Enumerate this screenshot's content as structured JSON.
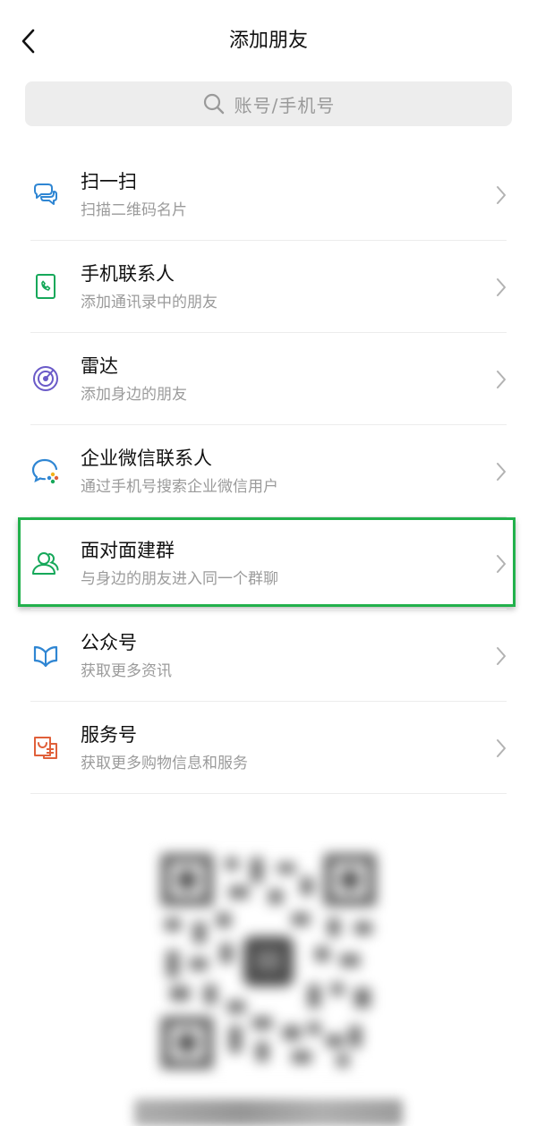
{
  "header": {
    "title": "添加朋友"
  },
  "search": {
    "placeholder": "账号/手机号"
  },
  "menu": {
    "items": [
      {
        "title": "扫一扫",
        "subtitle": "扫描二维码名片",
        "icon": "scan-icon",
        "color": "#2f86d3"
      },
      {
        "title": "手机联系人",
        "subtitle": "添加通讯录中的朋友",
        "icon": "phone-contact-icon",
        "color": "#16a85a"
      },
      {
        "title": "雷达",
        "subtitle": "添加身边的朋友",
        "icon": "radar-icon",
        "color": "#6a5ac8"
      },
      {
        "title": "企业微信联系人",
        "subtitle": "通过手机号搜索企业微信用户",
        "icon": "wecom-icon",
        "color": "#2f86d3"
      },
      {
        "title": "面对面建群",
        "subtitle": "与身边的朋友进入同一个群聊",
        "icon": "group-icon",
        "color": "#16a85a"
      },
      {
        "title": "公众号",
        "subtitle": "获取更多资讯",
        "icon": "official-account-icon",
        "color": "#2f86d3"
      },
      {
        "title": "服务号",
        "subtitle": "获取更多购物信息和服务",
        "icon": "service-account-icon",
        "color": "#e0603a"
      }
    ]
  },
  "highlight": {
    "color": "#22b14c",
    "item_index": 4
  }
}
